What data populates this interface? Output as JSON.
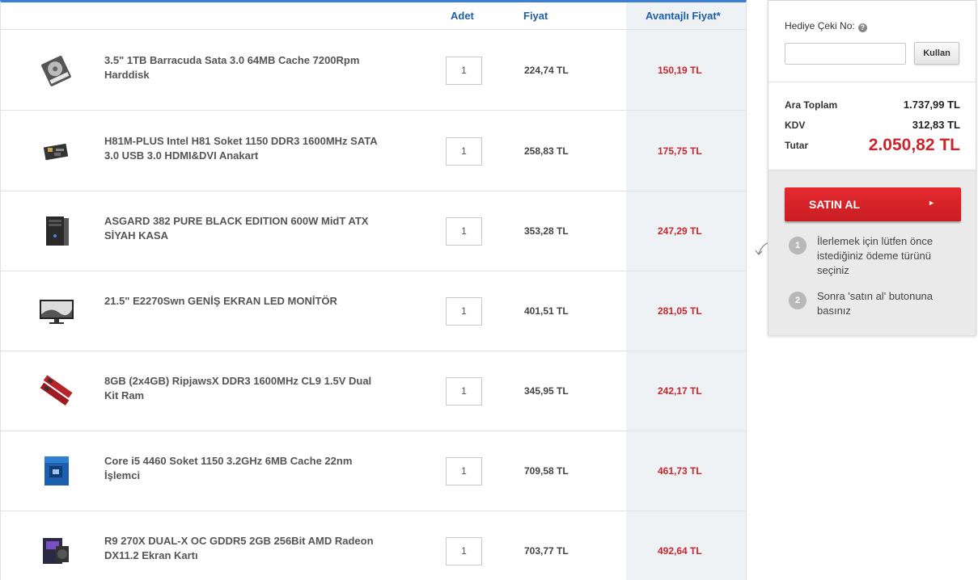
{
  "header": {
    "qty": "Adet",
    "price": "Fiyat",
    "adv_price": "Avantajlı Fiyat*"
  },
  "items": [
    {
      "name": "3.5\" 1TB Barracuda Sata 3.0 64MB Cache 7200Rpm Harddisk",
      "qty": "1",
      "price": "224,74 TL",
      "adv_price": "150,19 TL",
      "icon": "hard-disk-icon"
    },
    {
      "name": "H81M-PLUS Intel H81 Soket 1150 DDR3 1600MHz SATA 3.0 USB 3.0 HDMI&DVI Anakart",
      "qty": "1",
      "price": "258,83 TL",
      "adv_price": "175,75 TL",
      "icon": "motherboard-icon"
    },
    {
      "name": "ASGARD 382 PURE BLACK EDITION 600W MidT ATX SİYAH KASA",
      "qty": "1",
      "price": "353,28 TL",
      "adv_price": "247,29 TL",
      "icon": "pc-case-icon"
    },
    {
      "name": "21.5\" E2270Swn GENİŞ EKRAN LED MONİTÖR",
      "qty": "1",
      "price": "401,51 TL",
      "adv_price": "281,05 TL",
      "icon": "monitor-icon"
    },
    {
      "name": "8GB (2x4GB) RipjawsX DDR3 1600MHz CL9 1.5V Dual Kit Ram",
      "qty": "1",
      "price": "345,95 TL",
      "adv_price": "242,17 TL",
      "icon": "ram-icon"
    },
    {
      "name": "Core i5 4460 Soket 1150 3.2GHz 6MB Cache 22nm İşlemci",
      "qty": "1",
      "price": "709,58 TL",
      "adv_price": "461,73 TL",
      "icon": "cpu-box-icon"
    },
    {
      "name": "R9 270X DUAL-X OC GDDR5 2GB 256Bit AMD Radeon DX11.2 Ekran Kartı",
      "qty": "1",
      "price": "703,77 TL",
      "adv_price": "492,64 TL",
      "icon": "graphics-card-icon"
    }
  ],
  "sidebar": {
    "gift_label": "Hediye Çeki No:",
    "help_glyph": "?",
    "gift_placeholder": "",
    "use_button": "Kullan",
    "subtotal_label": "Ara Toplam",
    "subtotal": "1.737,99 TL",
    "vat_label": "KDV",
    "vat": "312,83 TL",
    "total_label": "Tutar",
    "total": "2.050,82 TL",
    "buy_button": "SATIN AL",
    "buy_arrow": "►",
    "steps": [
      {
        "num": "1",
        "text": "İlerlemek için lütfen önce istediğiniz ödeme türünü seçiniz"
      },
      {
        "num": "2",
        "text": "Sonra 'satın al' butonuna basınız"
      }
    ]
  },
  "colors": {
    "accent_blue": "#1f5fa6",
    "top_bar": "#3b7fd4",
    "discount_red": "#c9252c",
    "buy_red": "#d92227"
  }
}
